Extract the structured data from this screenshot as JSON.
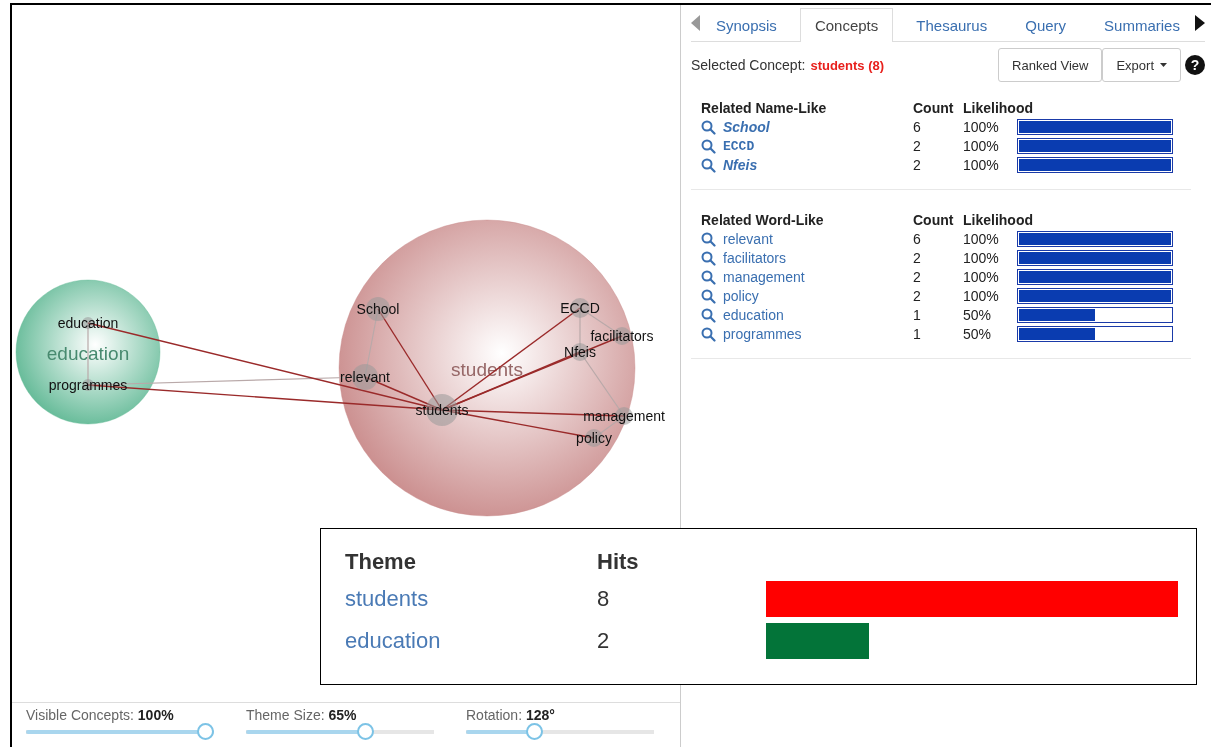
{
  "concept_map": {
    "themes": [
      {
        "label": "education",
        "color": "#5fb894",
        "concepts": [
          "education",
          "programmes"
        ]
      },
      {
        "label": "students",
        "color": "#c98a8a",
        "concepts": [
          "School",
          "relevant",
          "students",
          "ECCD",
          "facilitators",
          "Nfeis",
          "management",
          "policy"
        ]
      }
    ]
  },
  "sliders": [
    {
      "label": "Visible Concepts:",
      "value": "100%",
      "level": 1
    },
    {
      "label": "Theme Size:",
      "value": "65%",
      "level": 0.65
    },
    {
      "label": "Rotation:",
      "value": "128°",
      "level": 0.35
    }
  ],
  "tabs": [
    {
      "label": "Synopsis",
      "selected": false
    },
    {
      "label": "Concepts",
      "selected": true
    },
    {
      "label": "Thesaurus",
      "selected": false
    },
    {
      "label": "Query",
      "selected": false
    },
    {
      "label": "Summaries",
      "selected": false
    }
  ],
  "selected_concept": {
    "label": "Selected Concept:",
    "value": "students (8)"
  },
  "buttons": [
    {
      "label": "Ranked View",
      "dropdown": false
    },
    {
      "label": "Export",
      "dropdown": true
    }
  ],
  "help": "?",
  "sections": [
    {
      "title": "Related Name-Like",
      "count_header": "Count",
      "likelihood_header": "Likelihood",
      "items": [
        {
          "label": "School",
          "kind": "italic",
          "count": "6",
          "likelihood": "100%",
          "level": 1
        },
        {
          "label": "ECCD",
          "kind": "mono",
          "count": "2",
          "likelihood": "100%",
          "level": 1
        },
        {
          "label": "Nfeis",
          "kind": "italic",
          "count": "2",
          "likelihood": "100%",
          "level": 1
        }
      ]
    },
    {
      "title": "Related Word-Like",
      "count_header": "Count",
      "likelihood_header": "Likelihood",
      "items": [
        {
          "label": "relevant",
          "kind": "plain",
          "count": "6",
          "likelihood": "100%",
          "level": 1
        },
        {
          "label": "facilitators",
          "kind": "plain",
          "count": "2",
          "likelihood": "100%",
          "level": 1
        },
        {
          "label": "management",
          "kind": "plain",
          "count": "2",
          "likelihood": "100%",
          "level": 1
        },
        {
          "label": "policy",
          "kind": "plain",
          "count": "2",
          "likelihood": "100%",
          "level": 1
        },
        {
          "label": "education",
          "kind": "plain",
          "count": "1",
          "likelihood": "50%",
          "level": 0.5
        },
        {
          "label": "programmes",
          "kind": "plain",
          "count": "1",
          "likelihood": "50%",
          "level": 0.5
        }
      ]
    }
  ],
  "theme_popup": {
    "columns": [
      "Theme",
      "Hits"
    ],
    "rows": [
      {
        "theme": "students",
        "hits": "8",
        "color": "#ff0000"
      },
      {
        "theme": "education",
        "hits": "2",
        "color": "#037439"
      }
    ]
  }
}
